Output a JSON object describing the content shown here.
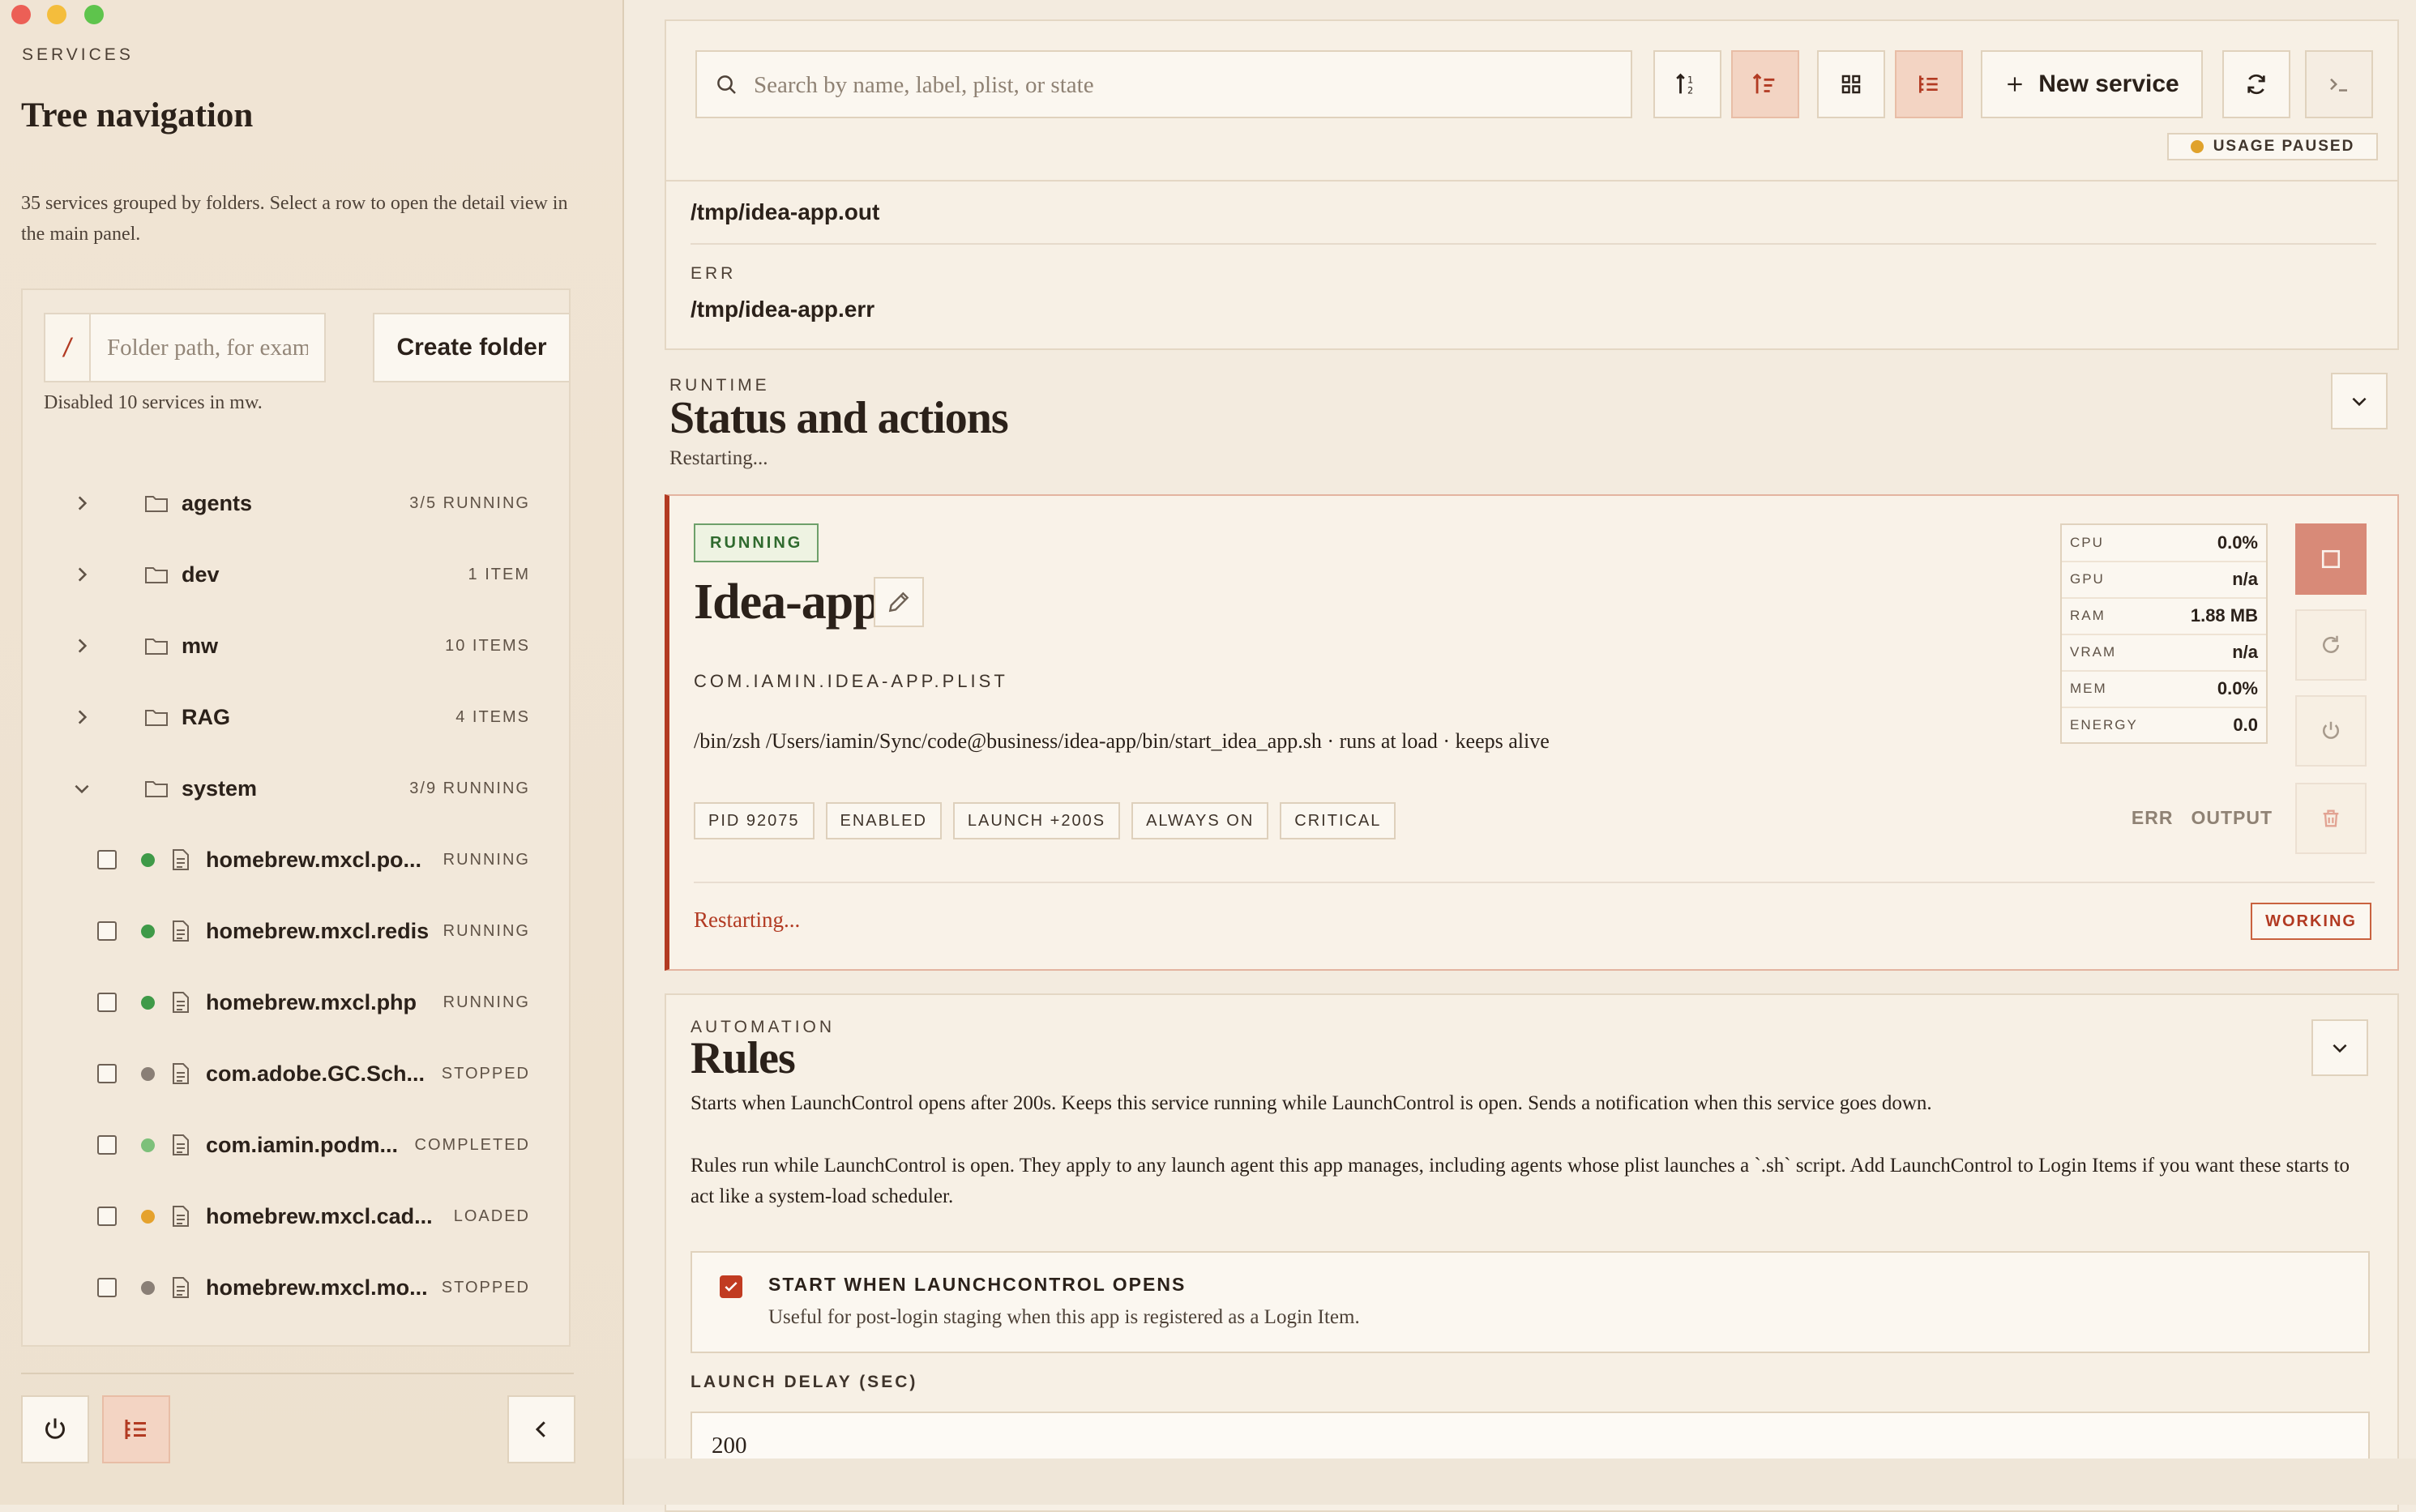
{
  "sidebar": {
    "eyebrow": "SERVICES",
    "title": "Tree navigation",
    "description": "35 services grouped by folders. Select a row to open the detail view in the main panel.",
    "folder_prefix": "/",
    "folder_placeholder": "Folder path, for example",
    "create_folder_label": "Create folder",
    "status_message": "Disabled 10 services in mw.",
    "folders": [
      {
        "label": "agents",
        "meta": "3/5 RUNNING",
        "expanded": false
      },
      {
        "label": "dev",
        "meta": "1 ITEM",
        "expanded": false
      },
      {
        "label": "mw",
        "meta": "10 ITEMS",
        "expanded": false
      },
      {
        "label": "RAG",
        "meta": "4 ITEMS",
        "expanded": false
      },
      {
        "label": "system",
        "meta": "3/9 RUNNING",
        "expanded": true
      }
    ],
    "services": [
      {
        "label": "homebrew.mxcl.po...",
        "state": "RUNNING",
        "dot_color": "#3f9a48"
      },
      {
        "label": "homebrew.mxcl.redis",
        "state": "RUNNING",
        "dot_color": "#3f9a48"
      },
      {
        "label": "homebrew.mxcl.php",
        "state": "RUNNING",
        "dot_color": "#3f9a48"
      },
      {
        "label": "com.adobe.GC.Sch...",
        "state": "STOPPED",
        "dot_color": "#8a7f76"
      },
      {
        "label": "com.iamin.podm...",
        "state": "COMPLETED",
        "dot_color": "#7dc07a"
      },
      {
        "label": "homebrew.mxcl.cad...",
        "state": "LOADED",
        "dot_color": "#e5a22d"
      },
      {
        "label": "homebrew.mxcl.mo...",
        "state": "STOPPED",
        "dot_color": "#8a7f76"
      }
    ]
  },
  "toolbar": {
    "search_placeholder": "Search by name, label, plist, or state",
    "new_service_label": "New service",
    "usage_label": "USAGE PAUSED"
  },
  "paths": {
    "out_path": "/tmp/idea-app.out",
    "err_label": "ERR",
    "err_path": "/tmp/idea-app.err"
  },
  "runtime": {
    "eyebrow": "RUNTIME",
    "title": "Status and actions",
    "subtitle": "Restarting..."
  },
  "service": {
    "status_badge": "RUNNING",
    "name": "Idea-app",
    "plist": "COM.IAMIN.IDEA-APP.PLIST",
    "command": "/bin/zsh /Users/iamin/Sync/code@business/idea-app/bin/start_idea_app.sh · runs at load · keeps alive",
    "tags": [
      "PID 92075",
      "ENABLED",
      "LAUNCH +200S",
      "ALWAYS ON",
      "CRITICAL"
    ],
    "log_links": [
      "ERR",
      "OUTPUT"
    ],
    "footer_status": "Restarting...",
    "working_badge": "WORKING",
    "metrics": [
      {
        "name": "CPU",
        "value": "0.0%"
      },
      {
        "name": "GPU",
        "value": "n/a"
      },
      {
        "name": "RAM",
        "value": "1.88 MB"
      },
      {
        "name": "VRAM",
        "value": "n/a"
      },
      {
        "name": "MEM",
        "value": "0.0%"
      },
      {
        "name": "ENERGY",
        "value": "0.0"
      }
    ]
  },
  "automation": {
    "eyebrow": "AUTOMATION",
    "title": "Rules",
    "summary": "Starts when LaunchControl opens after 200s. Keeps this service running while LaunchControl is open. Sends a notification when this service goes down.",
    "note": "Rules run while LaunchControl is open. They apply to any launch agent this app manages, including agents whose plist launches a `.sh` script. Add LaunchControl to Login Items if you want these starts to act like a system-load scheduler.",
    "start_option_label": "START WHEN LAUNCHCONTROL OPENS",
    "start_option_help": "Useful for post-login staging when this app is registered as a Login Item.",
    "start_option_checked": true,
    "delay_label": "LAUNCH DELAY (SEC)",
    "delay_value": "200"
  },
  "colors": {
    "accent": "#b23a22",
    "accent_soft": "#f3d4c3",
    "running_green": "#3f9a48",
    "stopped_gray": "#8a7f76",
    "loaded_amber": "#e5a22d",
    "background": "#f3ebdf"
  },
  "icons": {
    "toolbar": [
      "sort-az-icon",
      "sort-tree-icon",
      "grid-view-icon",
      "tree-view-icon",
      "plus-icon",
      "refresh-icon",
      "terminal-icon"
    ],
    "actions": [
      "stop-icon",
      "restart-icon",
      "power-icon",
      "trash-icon"
    ]
  }
}
